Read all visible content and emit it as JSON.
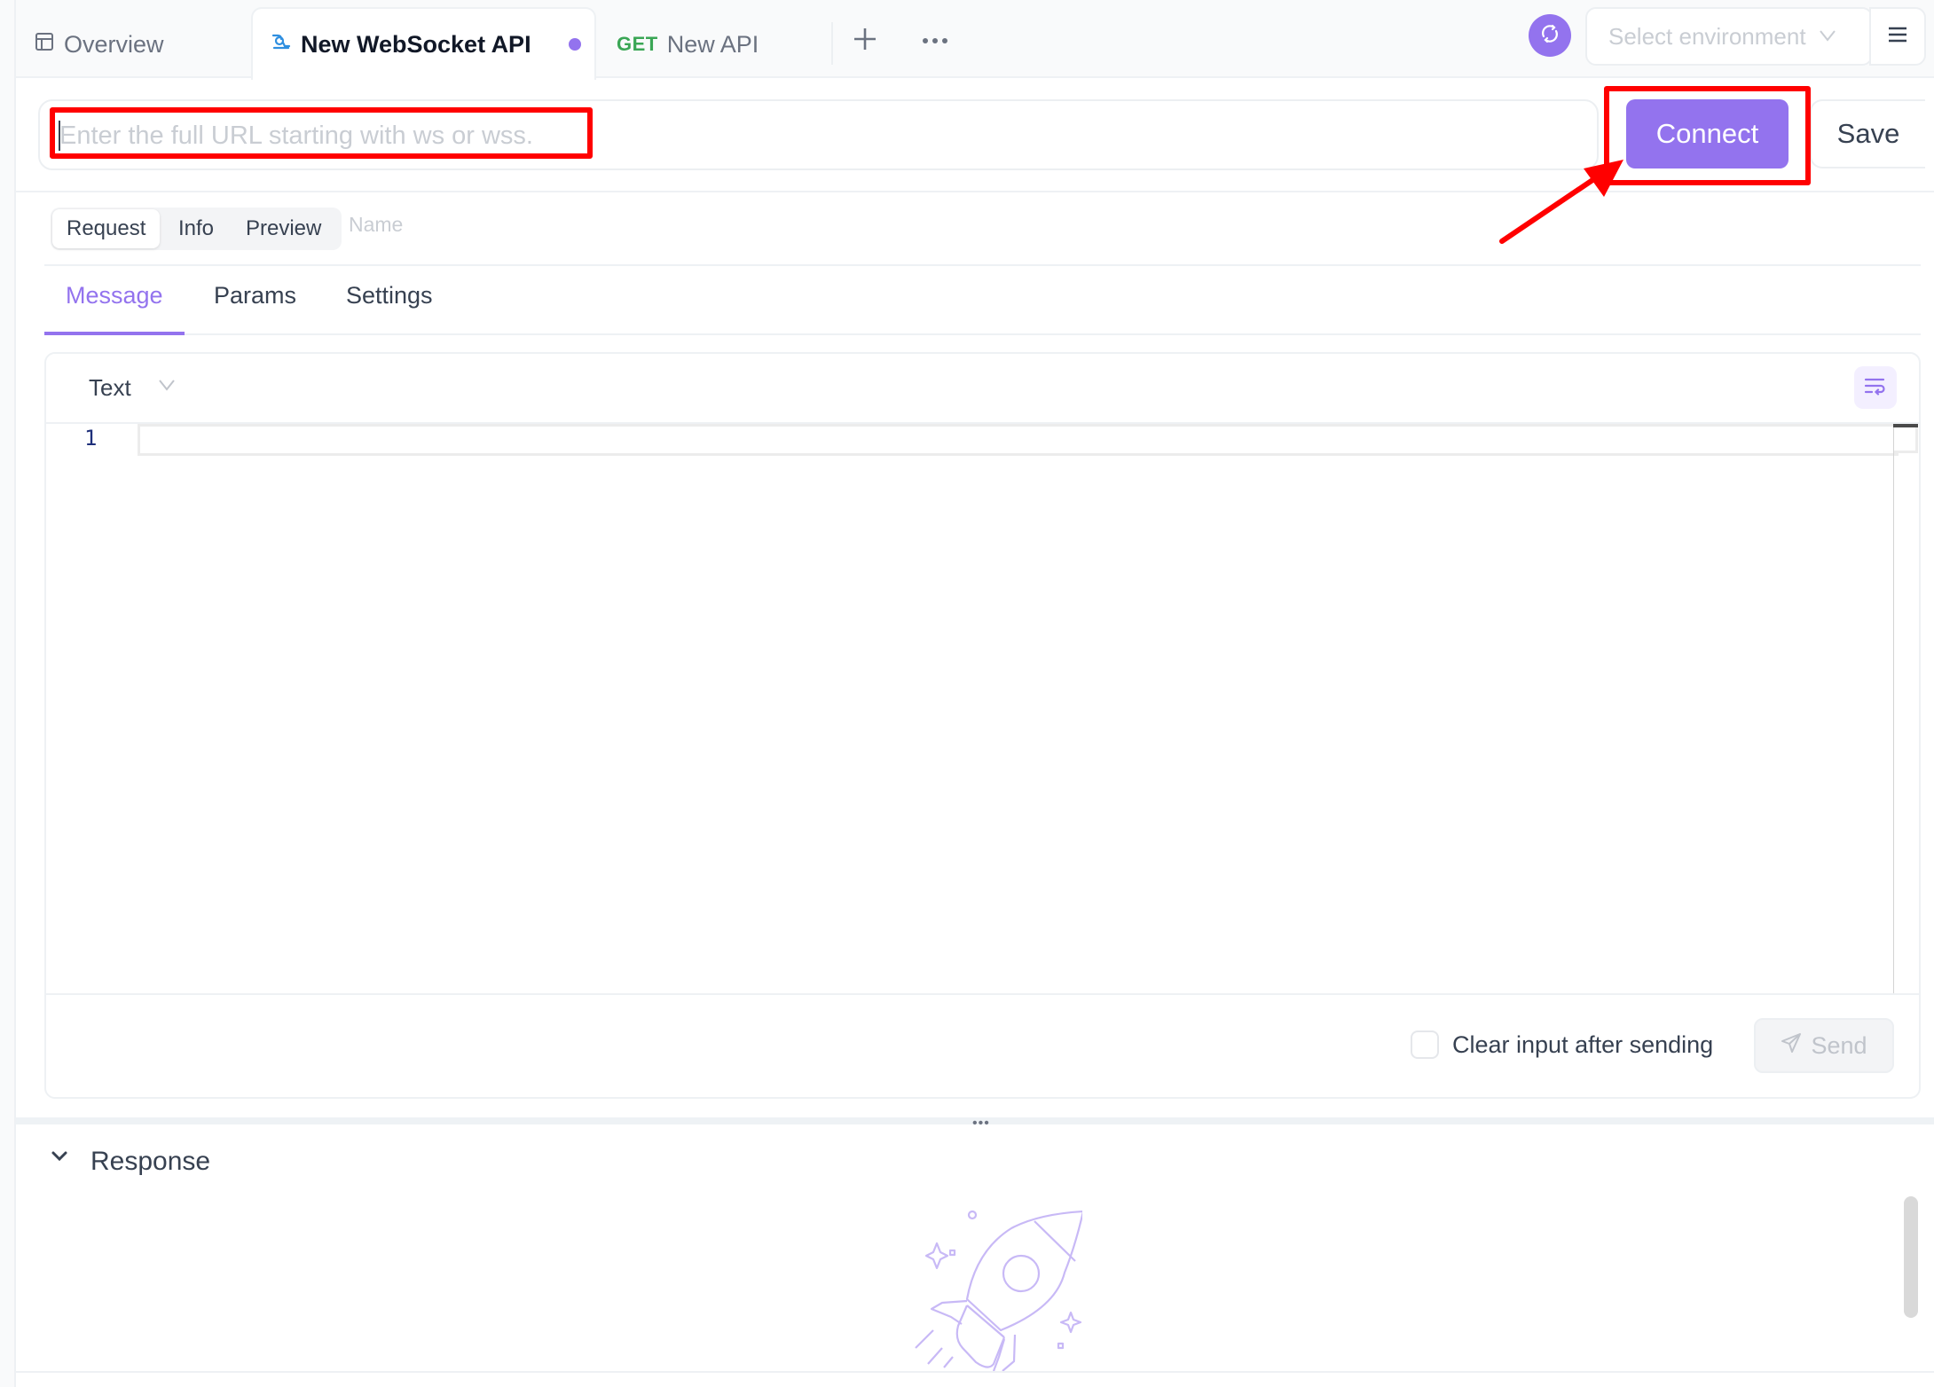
{
  "tabs": [
    {
      "label": "Overview",
      "icon": "layout-icon",
      "active": false
    },
    {
      "label": "New WebSocket API",
      "icon": "websocket-icon",
      "active": true,
      "unsaved_dot": true
    },
    {
      "label": "New API",
      "method": "GET",
      "active": false
    }
  ],
  "tab_actions": {
    "add": "+",
    "more": "•••"
  },
  "header": {
    "environment_placeholder": "Select environment",
    "sync_icon": "sync-icon",
    "menu_icon": "hamburger-icon"
  },
  "url_bar": {
    "placeholder": "Enter the full URL starting with ws or wss.",
    "value": "",
    "connect_label": "Connect",
    "save_label": "Save"
  },
  "view_switch": {
    "items": [
      "Request",
      "Info",
      "Preview"
    ],
    "active": "Request",
    "name_placeholder": "Name"
  },
  "subtabs": {
    "items": [
      "Message",
      "Params",
      "Settings"
    ],
    "active": "Message"
  },
  "editor": {
    "format": "Text",
    "line_numbers": [
      "1"
    ],
    "content": "",
    "wrap_icon": "wrap-lines-icon"
  },
  "footer": {
    "clear_input_label": "Clear input after sending",
    "clear_input_checked": false,
    "send_label": "Send"
  },
  "response": {
    "title": "Response",
    "splitter_handle": "•••",
    "illustration": "rocket-illustration"
  },
  "colors": {
    "accent": "#9373ee",
    "get_method": "#3aa655",
    "annotation": "#ff0000"
  }
}
